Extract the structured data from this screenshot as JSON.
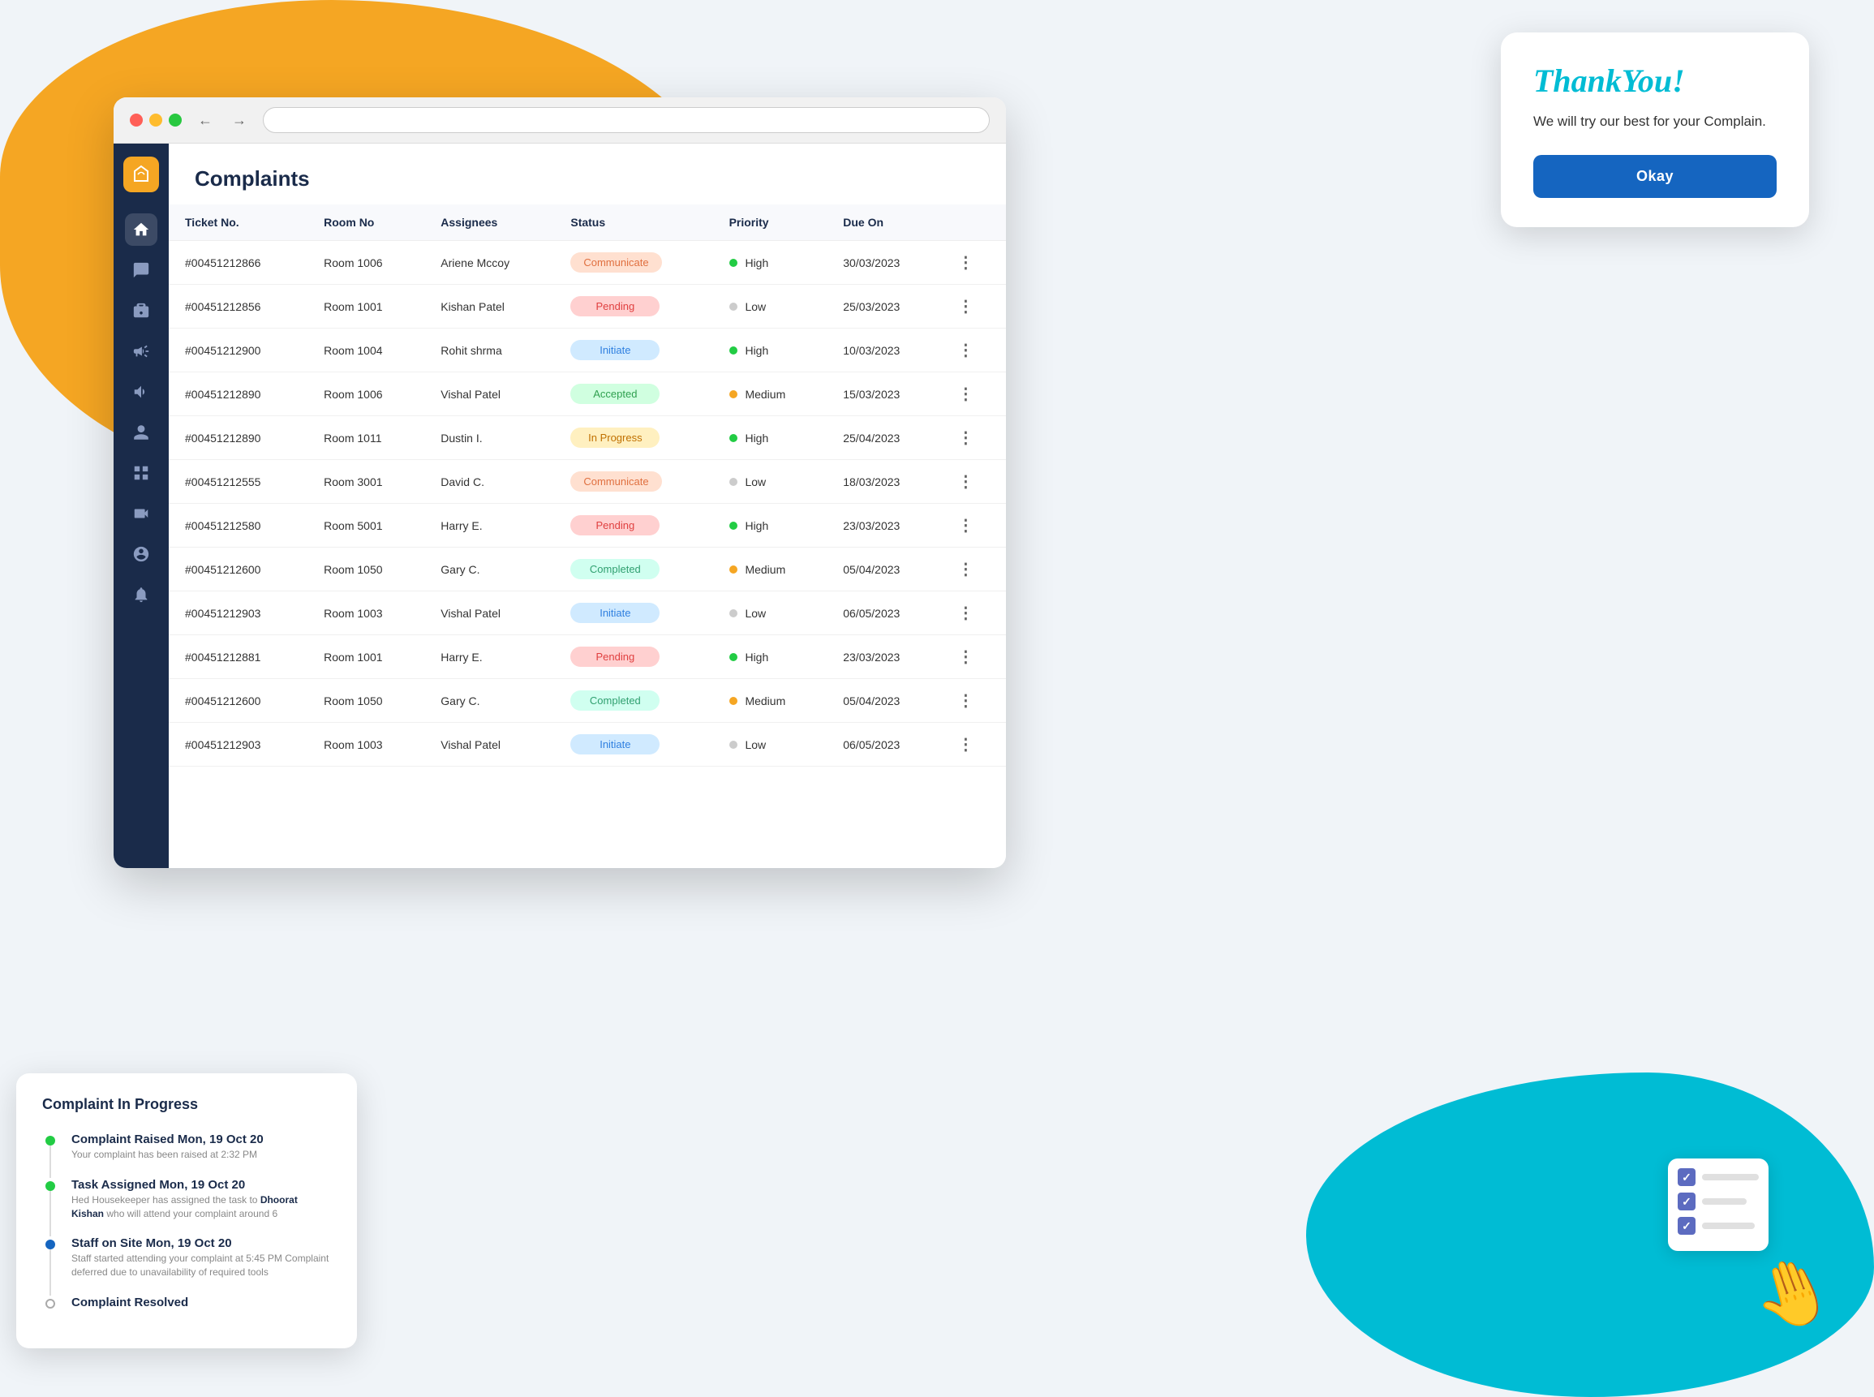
{
  "background": {
    "blob_color": "#f5a623",
    "blob_blue_color": "#00bcd4"
  },
  "browser": {
    "dots": [
      "red",
      "yellow",
      "green"
    ]
  },
  "sidebar": {
    "icons": [
      "home",
      "chat",
      "briefcase",
      "megaphone",
      "megaphone2",
      "person",
      "grid",
      "video",
      "user",
      "bell"
    ]
  },
  "page": {
    "title": "Complaints"
  },
  "table": {
    "headers": [
      "Ticket No.",
      "Room No",
      "Assignees",
      "Status",
      "Priority",
      "Due On",
      ""
    ],
    "rows": [
      {
        "ticket": "#00451212866",
        "room": "Room 1006",
        "assignee": "Ariene Mccoy",
        "status": "Communicate",
        "status_class": "communicate",
        "priority": "High",
        "priority_class": "high",
        "due_on": "30/03/2023"
      },
      {
        "ticket": "#00451212856",
        "room": "Room 1001",
        "assignee": "Kishan Patel",
        "status": "Pending",
        "status_class": "pending",
        "priority": "Low",
        "priority_class": "low",
        "due_on": "25/03/2023"
      },
      {
        "ticket": "#00451212900",
        "room": "Room 1004",
        "assignee": "Rohit shrma",
        "status": "Initiate",
        "status_class": "initiate",
        "priority": "High",
        "priority_class": "high",
        "due_on": "10/03/2023"
      },
      {
        "ticket": "#00451212890",
        "room": "Room 1006",
        "assignee": "Vishal Patel",
        "status": "Accepted",
        "status_class": "accepted",
        "priority": "Medium",
        "priority_class": "medium",
        "due_on": "15/03/2023"
      },
      {
        "ticket": "#00451212890",
        "room": "Room 1011",
        "assignee": "Dustin I.",
        "status": "In Progress",
        "status_class": "inprogress",
        "priority": "High",
        "priority_class": "high",
        "due_on": "25/04/2023"
      },
      {
        "ticket": "#00451212555",
        "room": "Room 3001",
        "assignee": "David C.",
        "status": "Communicate",
        "status_class": "communicate",
        "priority": "Low",
        "priority_class": "low",
        "due_on": "18/03/2023"
      },
      {
        "ticket": "#00451212580",
        "room": "Room 5001",
        "assignee": "Harry E.",
        "status": "Pending",
        "status_class": "pending",
        "priority": "High",
        "priority_class": "high",
        "due_on": "23/03/2023"
      },
      {
        "ticket": "#00451212600",
        "room": "Room 1050",
        "assignee": "Gary C.",
        "status": "Completed",
        "status_class": "completed",
        "priority": "Medium",
        "priority_class": "medium",
        "due_on": "05/04/2023"
      },
      {
        "ticket": "#00451212903",
        "room": "Room 1003",
        "assignee": "Vishal Patel",
        "status": "Initiate",
        "status_class": "initiate",
        "priority": "Low",
        "priority_class": "low",
        "due_on": "06/05/2023"
      },
      {
        "ticket": "#00451212881",
        "room": "Room 1001",
        "assignee": "Harry E.",
        "status": "Pending",
        "status_class": "pending",
        "priority": "High",
        "priority_class": "high",
        "due_on": "23/03/2023"
      },
      {
        "ticket": "#00451212600",
        "room": "Room 1050",
        "assignee": "Gary C.",
        "status": "Completed",
        "status_class": "completed",
        "priority": "Medium",
        "priority_class": "medium",
        "due_on": "05/04/2023"
      },
      {
        "ticket": "#00451212903",
        "room": "Room 1003",
        "assignee": "Vishal Patel",
        "status": "Initiate",
        "status_class": "initiate",
        "priority": "Low",
        "priority_class": "low",
        "due_on": "06/05/2023"
      }
    ]
  },
  "thankyou_card": {
    "title": "ThankYou!",
    "message": "We will try our best for your Complain.",
    "button_label": "Okay"
  },
  "progress_card": {
    "title": "Complaint In Progress",
    "steps": [
      {
        "title": "Complaint Raised Mon, 19 Oct 20",
        "subtitle": "Your complaint has been raised at 2:32 PM",
        "dot_class": "green",
        "completed": true
      },
      {
        "title": "Task Assigned Mon, 19 Oct 20",
        "subtitle": "Hed Housekeeper has assigned the task to Dhoorat Kishan who will attend your complaint around 6",
        "dot_class": "green",
        "completed": true
      },
      {
        "title": "Staff on Site Mon, 19 Oct 20",
        "subtitle": "Staff started attending your complaint at 5:45 PM\nComplaint deferred due to unavailability of required tools",
        "dot_class": "blue",
        "completed": false
      },
      {
        "title": "Complaint Resolved",
        "subtitle": "",
        "dot_class": "gray",
        "completed": false
      }
    ]
  }
}
